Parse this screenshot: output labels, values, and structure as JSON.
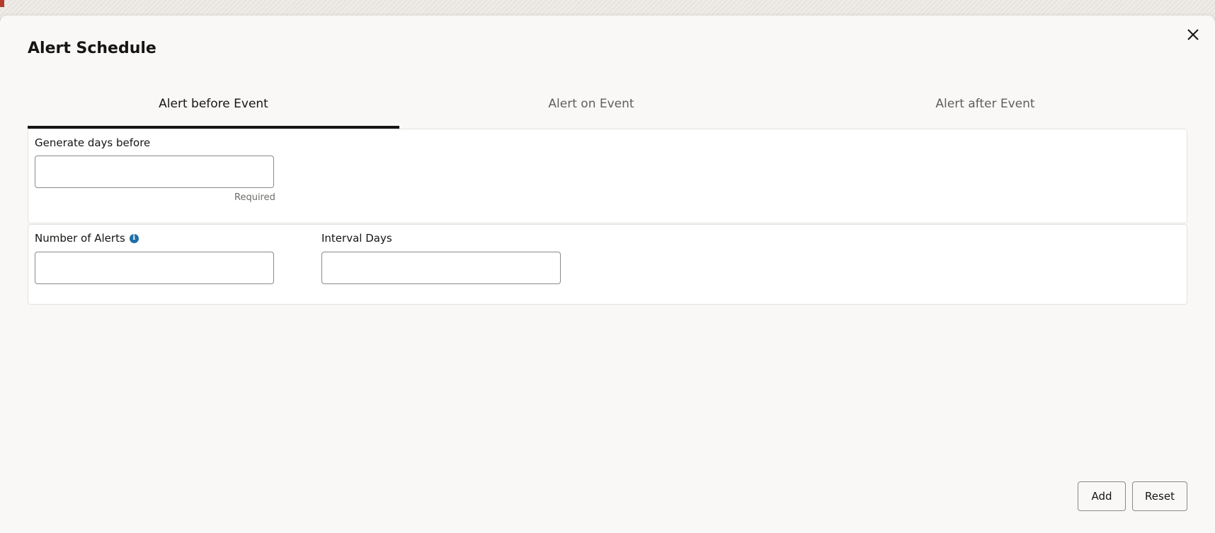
{
  "dialog": {
    "title": "Alert Schedule",
    "close_icon": "close-icon"
  },
  "tabs": [
    {
      "label": "Alert before Event",
      "active": true
    },
    {
      "label": "Alert on Event",
      "active": false
    },
    {
      "label": "Alert after Event",
      "active": false
    }
  ],
  "panel_1": {
    "generate_days_before": {
      "label": "Generate days before",
      "value": "",
      "placeholder": "",
      "helper": "Required"
    }
  },
  "panel_2": {
    "number_of_alerts": {
      "label": "Number of Alerts",
      "info_icon": "info-icon",
      "value": "",
      "placeholder": ""
    },
    "interval_days": {
      "label": "Interval Days",
      "value": "",
      "placeholder": ""
    }
  },
  "actions": {
    "add_label": "Add",
    "reset_label": "Reset"
  },
  "colors": {
    "dialog_bg": "#f9f8f6",
    "text": "#161513",
    "tab_inactive": "#5f5e5b",
    "info_blue": "#1f6ea8",
    "border": "#8c8a86"
  }
}
